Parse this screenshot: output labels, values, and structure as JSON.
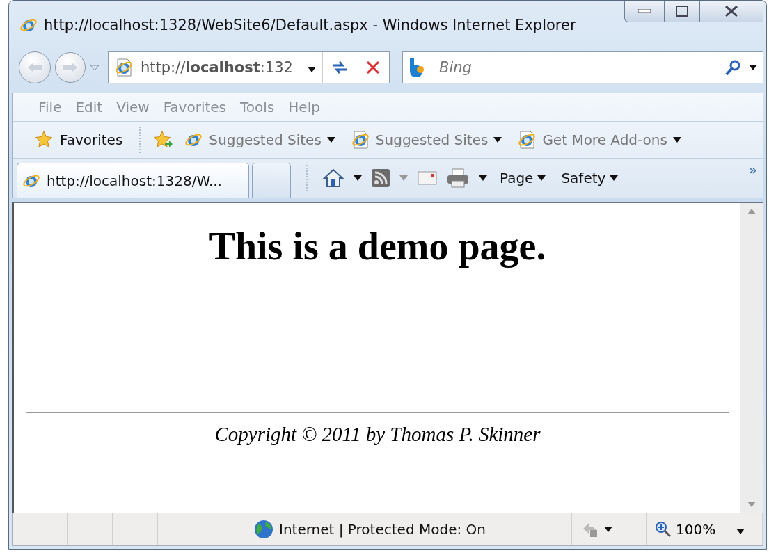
{
  "window": {
    "title": "http://localhost:1328/WebSite6/Default.aspx - Windows Internet Explorer"
  },
  "address_bar": {
    "value": "http://**localhost**:132"
  },
  "search": {
    "placeholder": "Bing"
  },
  "menu": [
    "File",
    "Edit",
    "View",
    "Favorites",
    "Tools",
    "Help"
  ],
  "favorites_bar": {
    "label": "Favorites",
    "links": [
      {
        "label": "Suggested Sites",
        "kind": "globe"
      },
      {
        "label": "Suggested Sites",
        "kind": "page"
      },
      {
        "label": "Get More Add-ons",
        "kind": "page"
      }
    ]
  },
  "tabs": [
    {
      "label": "http://localhost:1328/W...",
      "selected": true
    }
  ],
  "command_bar": {
    "items": [
      "Page",
      "Safety"
    ],
    "overflow": "»"
  },
  "page": {
    "heading": "This is a demo page.",
    "footer": "Copyright © 2011 by Thomas P. Skinner"
  },
  "status_bar": {
    "zone": "Internet | Protected Mode: On",
    "zoom": "100%"
  }
}
